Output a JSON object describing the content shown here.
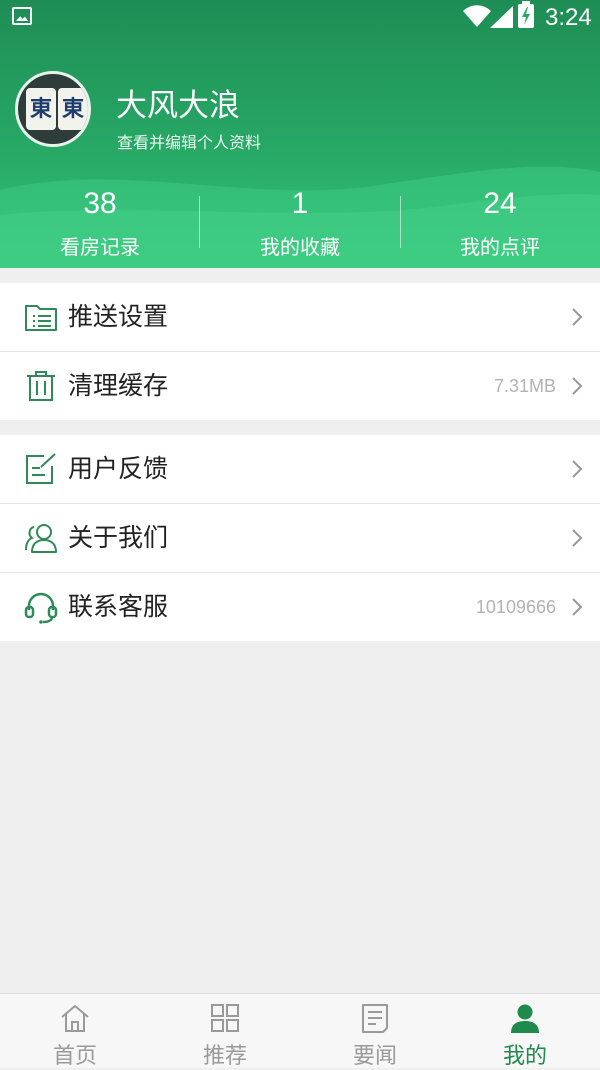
{
  "statusbar": {
    "time": "3:24"
  },
  "profile": {
    "avatar_tiles": [
      "東",
      "東"
    ],
    "name": "大风大浪",
    "subtitle": "查看并编辑个人资料"
  },
  "stats": [
    {
      "value": "38",
      "label": "看房记录"
    },
    {
      "value": "1",
      "label": "我的收藏"
    },
    {
      "value": "24",
      "label": "我的点评"
    }
  ],
  "menu_group1": [
    {
      "icon": "folder-list-icon",
      "label": "推送设置",
      "value": ""
    },
    {
      "icon": "trash-icon",
      "label": "清理缓存",
      "value": "7.31MB"
    }
  ],
  "menu_group2": [
    {
      "icon": "edit-note-icon",
      "label": "用户反馈",
      "value": ""
    },
    {
      "icon": "users-icon",
      "label": "关于我们",
      "value": ""
    },
    {
      "icon": "headset-icon",
      "label": "联系客服",
      "value": "10109666"
    }
  ],
  "tabbar": [
    {
      "icon": "home-icon",
      "label": "首页",
      "active": false
    },
    {
      "icon": "grid-icon",
      "label": "推荐",
      "active": false
    },
    {
      "icon": "news-icon",
      "label": "要闻",
      "active": false
    },
    {
      "icon": "person-icon",
      "label": "我的",
      "active": true
    }
  ],
  "colors": {
    "primary": "#1e8d55",
    "accent_light": "#35c57b",
    "icon_green": "#2e8b57",
    "value_gray": "#b3b3b3"
  }
}
